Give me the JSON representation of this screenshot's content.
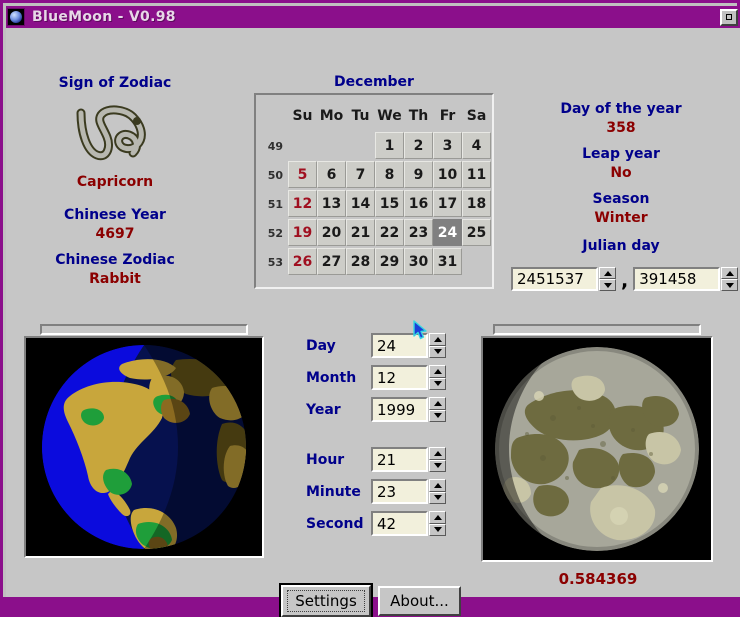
{
  "window": {
    "title": "BlueMoon - V0.98",
    "app_icon": "bluemoon-globe-icon",
    "restore_button": "restore-window-button",
    "titlebar_color": "#8b0f8b",
    "client_color": "#c6c6c6"
  },
  "zodiac": {
    "heading": "Sign of Zodiac",
    "sign_symbol": "capricorn-glyph",
    "sign_name": "Capricorn",
    "chinese_year_label": "Chinese Year",
    "chinese_year_value": "4697",
    "chinese_zodiac_label": "Chinese Zodiac",
    "chinese_zodiac_value": "Rabbit"
  },
  "calendar": {
    "month": "December",
    "weekday_headers": [
      "Su",
      "Mo",
      "Tu",
      "We",
      "Th",
      "Fr",
      "Sa"
    ],
    "week_numbers": [
      "49",
      "50",
      "51",
      "52",
      "53"
    ],
    "selected_day": "24",
    "rows": [
      [
        "",
        "",
        "",
        "1",
        "2",
        "3",
        "4"
      ],
      [
        "5",
        "6",
        "7",
        "8",
        "9",
        "10",
        "11"
      ],
      [
        "12",
        "13",
        "14",
        "15",
        "16",
        "17",
        "18"
      ],
      [
        "19",
        "20",
        "21",
        "22",
        "23",
        "24",
        "25"
      ],
      [
        "26",
        "27",
        "28",
        "29",
        "30",
        "31",
        ""
      ]
    ]
  },
  "info": {
    "day_of_year_label": "Day of the year",
    "day_of_year_value": "358",
    "leap_year_label": "Leap year",
    "leap_year_value": "No",
    "season_label": "Season",
    "season_value": "Winter",
    "julian_day_label": "Julian day",
    "julian_day_value": "2451537",
    "julian_fraction_value": "391458",
    "separator": ","
  },
  "datetime": {
    "day_label": "Day",
    "day_value": "24",
    "month_label": "Month",
    "month_value": "12",
    "year_label": "Year",
    "year_value": "1999",
    "hour_label": "Hour",
    "hour_value": "21",
    "minute_label": "Minute",
    "minute_value": "23",
    "second_label": "Second",
    "second_value": "42"
  },
  "earth": {
    "slider_name": "earth-view-slider",
    "image_name": "earth-globe-image"
  },
  "moon": {
    "slider_name": "moon-view-slider",
    "image_name": "moon-phase-image",
    "phase_value": "0.584369"
  },
  "buttons": {
    "settings": "Settings",
    "about": "About..."
  },
  "colors": {
    "label_blue": "#00008b",
    "value_red": "#8b0000",
    "sunday_red": "#a01020",
    "field_bg": "#f2f0dc",
    "selected_cell": "#808080"
  }
}
